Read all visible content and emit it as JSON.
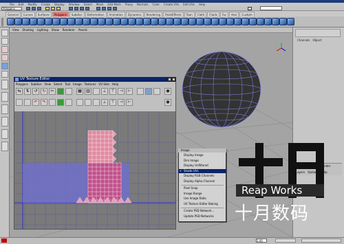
{
  "menubar": {
    "items": [
      "File",
      "Edit",
      "Modify",
      "Create",
      "Display",
      "Window",
      "Select",
      "Mesh",
      "Edit Mesh",
      "Proxy",
      "Normals",
      "Color",
      "Create UVs",
      "Edit UVs",
      "Help"
    ]
  },
  "status_line": {
    "mode": "Polygons"
  },
  "shelf_tabs": {
    "items": [
      {
        "label": "General",
        "active": false
      },
      {
        "label": "Curves",
        "active": false
      },
      {
        "label": "Surfaces",
        "active": false
      },
      {
        "label": "Polygons",
        "active": true
      },
      {
        "label": "Subdivs",
        "active": false
      },
      {
        "label": "Deformation",
        "active": false
      },
      {
        "label": "Animation",
        "active": false
      },
      {
        "label": "Dynamics",
        "active": false
      },
      {
        "label": "Rendering",
        "active": false
      },
      {
        "label": "PaintEffects",
        "active": false
      },
      {
        "label": "Toon",
        "active": false
      },
      {
        "label": "Cloth",
        "active": false
      },
      {
        "label": "Fluids",
        "active": false
      },
      {
        "label": "Fur",
        "active": false
      },
      {
        "label": "Hair",
        "active": false
      },
      {
        "label": "Custom",
        "active": false
      }
    ]
  },
  "viewport_menu": {
    "items": [
      "View",
      "Shading",
      "Lighting",
      "Show",
      "Renderer",
      "Panels"
    ]
  },
  "channel_box": {
    "tabs": [
      "Channels",
      "Object"
    ],
    "layers_label": "Display",
    "render_label": "Render",
    "layer_menu": [
      "Layers",
      "Options",
      "Help"
    ]
  },
  "uv_editor": {
    "title": "UV Texture Editor",
    "menu": [
      "Polygons",
      "Subdivs",
      "View",
      "Select",
      "Tool",
      "Image",
      "Textures",
      "UV Sets",
      "Help"
    ]
  },
  "context_menu": {
    "title": "Image",
    "items": [
      {
        "label": "Display Image",
        "checked": false,
        "sep_after": false
      },
      {
        "label": "Dim Image",
        "checked": false,
        "sep_after": false
      },
      {
        "label": "Display Unfiltered",
        "checked": false,
        "sep_after": false
      },
      {
        "label": "Shade UVs",
        "checked": true,
        "sep_after": false
      },
      {
        "label": "Display RGB Channels",
        "checked": false,
        "sep_after": false
      },
      {
        "label": "Display Alpha Channel",
        "checked": false,
        "sep_after": true
      },
      {
        "label": "Pixel Snap",
        "checked": false,
        "sep_after": false
      },
      {
        "label": "Image Range",
        "checked": false,
        "sep_after": false
      },
      {
        "label": "Use Image Ratio",
        "checked": false,
        "sep_after": false
      },
      {
        "label": "UV Texture Editor Baking",
        "checked": false,
        "sep_after": true
      },
      {
        "label": "Create PSD Network...",
        "checked": false,
        "sep_after": false
      },
      {
        "label": "Update PSD Networks",
        "checked": false,
        "sep_after": false
      }
    ]
  },
  "timeline": {
    "start": "1.00"
  },
  "watermark": {
    "brand_en": "Reap Works",
    "brand_cn": "十月数码"
  },
  "colors": {
    "selection": "#0a246a",
    "active_tab": "#ff7070",
    "uv_shells": "#d0607a",
    "grid": "#5d5d9a"
  }
}
